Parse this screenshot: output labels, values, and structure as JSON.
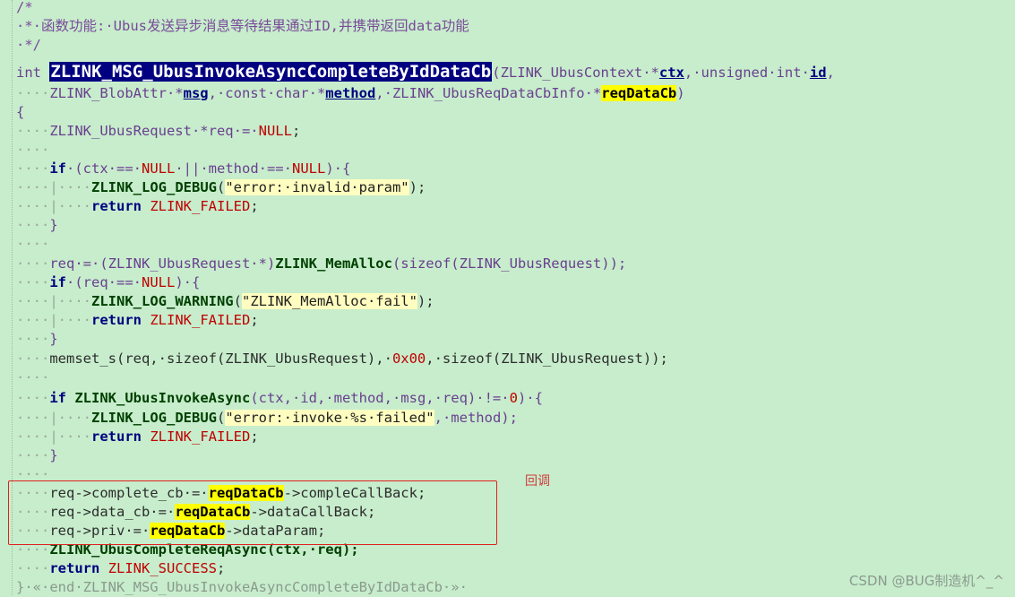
{
  "code": {
    "comment_open": "/*",
    "comment_body": "·*·函数功能:·Ubus发送异步消息等待结果通过ID,并携带返回data功能",
    "comment_close": "·*/",
    "kw_int": "int",
    "func_name": "ZLINK_MSG_UbusInvokeAsyncCompleteByIdDataCb",
    "sig1_rest_a": "ZLINK_UbusContext·*",
    "param_ctx": "ctx",
    "sig1_rest_b": ",·unsigned·int·",
    "param_id": "id",
    "sig1_tail": ",",
    "sig2_a": "ZLINK_BlobAttr·*",
    "param_msg": "msg",
    "sig2_b": ",·const·char·*",
    "param_method": "method",
    "sig2_c": ",·ZLINK_UbusReqDataCbInfo·*",
    "param_reqDataCb": "reqDataCb",
    "sig2_d": ")",
    "brace_open": "{",
    "decl": "ZLINK_UbusRequest·*req·=·",
    "null": "NULL",
    "semi": ";",
    "if_kw": "if",
    "cond1_a": "·(ctx·==·",
    "cond1_b": "·||·method·==·",
    "cond1_c": ")·{",
    "log_debug": "ZLINK_LOG_DEBUG",
    "str_invalid": "\"error:·invalid·param\"",
    "ret_kw": "return",
    "failed": "ZLINK_FAILED",
    "brace_close": "}",
    "alloc_a": "req·=·(ZLINK_UbusRequest·*)",
    "memalloc": "ZLINK_MemAlloc",
    "alloc_b": "(sizeof(ZLINK_UbusRequest));",
    "cond2_a": "·(req·==·",
    "cond2_b": ")·{",
    "log_warning": "ZLINK_LOG_WARNING",
    "str_alloc_fail": "\"ZLINK_MemAlloc·fail\"",
    "memset_line": "memset_s(req,·sizeof(ZLINK_UbusRequest),·",
    "hex0": "0x00",
    "memset_tail": ",·sizeof(ZLINK_UbusRequest));",
    "invoke_fn": "ZLINK_UbusInvokeAsync",
    "invoke_args": "(ctx,·id,·method,·msg,·req)·!=·",
    "zero": "0",
    "invoke_tail": ")·{",
    "str_invoke_failed": "\"error:·invoke·%s·failed\"",
    "invoke_log_tail": ",·method);",
    "cb1_a": "req->complete_cb·=·",
    "cb1_b": "->compleCallBack;",
    "cb2_a": "req->data_cb·=·",
    "cb2_b": "->dataCallBack;",
    "cb3_a": "req->priv·=·",
    "cb3_b": "->dataParam;",
    "complete_line": "ZLINK_UbusCompleteReqAsync(ctx,·req);",
    "success": "ZLINK_SUCCESS",
    "end_comment": "}·«·end·ZLINK_MSG_UbusInvokeAsyncCompleteByIdDataCb·»·"
  },
  "annotation": "回调",
  "watermark": "CSDN @BUG制造机^_^"
}
